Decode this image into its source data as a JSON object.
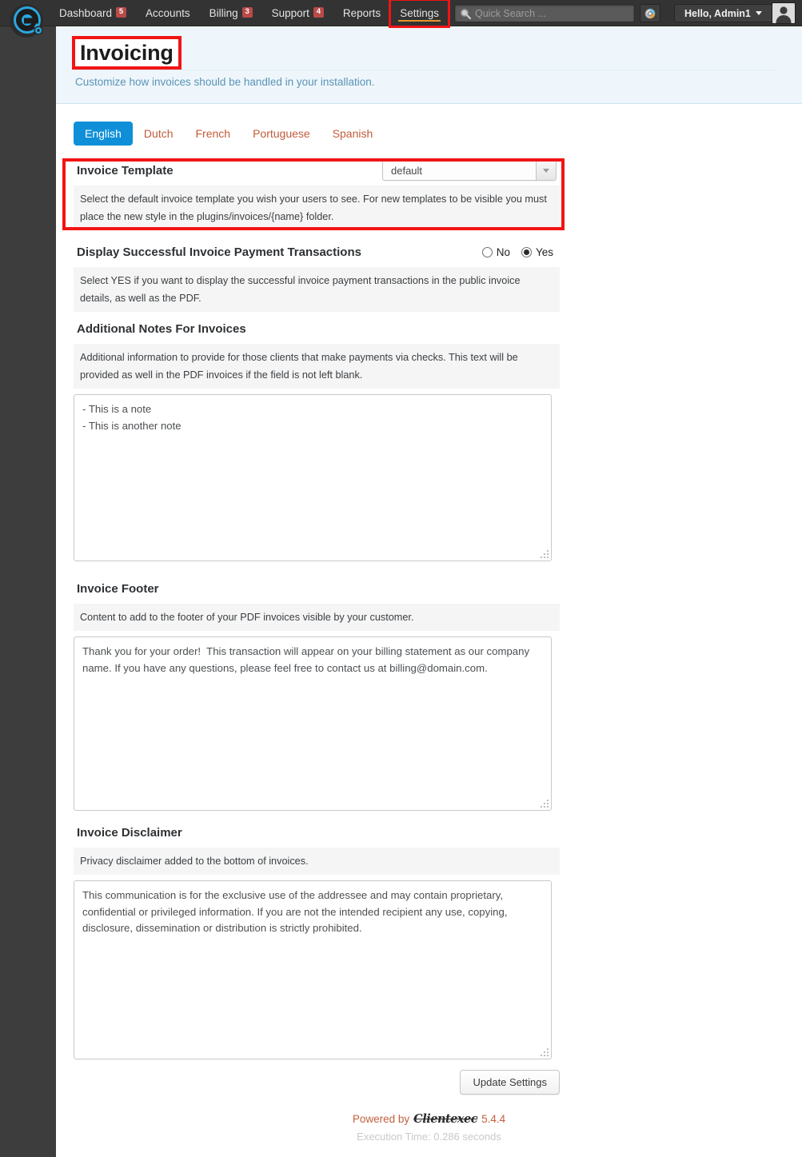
{
  "app": {
    "logo_icon": "clientexec-e-plus-logo"
  },
  "navbar": {
    "items": [
      {
        "label": "Dashboard",
        "badge": "5",
        "icon": "dashboard-icon",
        "highlighted": false
      },
      {
        "label": "Accounts",
        "badge": "",
        "icon": "accounts-icon",
        "highlighted": false
      },
      {
        "label": "Billing",
        "badge": "3",
        "icon": "billing-icon",
        "highlighted": false
      },
      {
        "label": "Support",
        "badge": "4",
        "icon": "support-icon",
        "highlighted": false
      },
      {
        "label": "Reports",
        "badge": "",
        "icon": "reports-icon",
        "highlighted": false
      },
      {
        "label": "Settings",
        "badge": "",
        "icon": "settings-icon",
        "highlighted": true
      }
    ],
    "search": {
      "placeholder": "Quick Search ...",
      "value": "",
      "icon": "search-icon"
    },
    "theme_button_icon": "color-wheel-icon",
    "user_menu_label": "Hello, Admin1",
    "avatar_icon": "user-avatar-icon"
  },
  "page": {
    "title": "Invoicing",
    "subtitle": "Customize how invoices should be handled in your installation."
  },
  "language_tabs": [
    {
      "label": "English",
      "active": true
    },
    {
      "label": "Dutch",
      "active": false
    },
    {
      "label": "French",
      "active": false
    },
    {
      "label": "Portuguese",
      "active": false
    },
    {
      "label": "Spanish",
      "active": false
    }
  ],
  "settings": {
    "invoice_template": {
      "label": "Invoice Template",
      "selected_option": "default",
      "options": [
        "default"
      ],
      "description": "Select the default invoice template you wish your users to see. For new templates to be visible you must place the new style in the plugins/invoices/{name} folder."
    },
    "display_transactions": {
      "label": "Display Successful Invoice Payment Transactions",
      "options": [
        {
          "label": "No",
          "checked": false
        },
        {
          "label": "Yes",
          "checked": true
        }
      ],
      "description": "Select YES if you want to display the successful invoice payment transactions in the public invoice details, as well as the PDF."
    },
    "additional_notes": {
      "label": "Additional Notes For Invoices",
      "description": "Additional information to provide for those clients that make payments via checks. This text will be provided as well in the PDF invoices if the field is not left blank.",
      "value": "- This is a note\n- This is another note"
    },
    "invoice_footer": {
      "label": "Invoice Footer",
      "description": "Content to add to the footer of your PDF invoices visible by your customer.",
      "value": "Thank you for your order!  This transaction will appear on your billing statement as our company name. If you have any questions, please feel free to contact us at billing@domain.com."
    },
    "invoice_disclaimer": {
      "label": "Invoice Disclaimer",
      "description": "Privacy disclaimer added to the bottom of invoices.",
      "value": "This communication is for the exclusive use of the addressee and may contain proprietary, confidential or privileged information. If you are not the intended recipient any use, copying, disclosure, dissemination or distribution is strictly prohibited."
    }
  },
  "actions": {
    "update_settings_label": "Update Settings"
  },
  "footer": {
    "powered_by": "Powered by",
    "brand": "Clientexec",
    "version": "5.4.4",
    "execution_time": "Execution Time: 0.286 seconds"
  },
  "annotations": {
    "highlight_color": "#f21414"
  },
  "colors": {
    "accent_blue": "#0f8fd8",
    "link_orange": "#c15b3a",
    "navbar_bg": "#333333",
    "header_band": "#eef6fc",
    "badge_red": "#b94a48"
  }
}
